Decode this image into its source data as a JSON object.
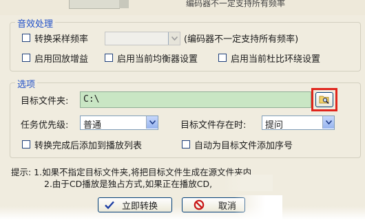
{
  "top": {
    "hint_text": "编码器不一定支持所有频率"
  },
  "audio_group": {
    "title": "音效处理",
    "convert_samplerate_label": "转换采样频率",
    "samplerate_value": "",
    "samplerate_note": "(编码器不一定支持所有频率)",
    "replay_gain_label": "启用回放增益",
    "equalizer_label": "启用当前均衡器设置",
    "dolby_label": "启用当前杜比环绕设置"
  },
  "options_group": {
    "title": "选项",
    "target_folder_label": "目标文件夹:",
    "target_folder_value": "C:\\",
    "priority_label": "任务优先级:",
    "priority_value": "普通",
    "exists_label": "目标文件存在时:",
    "exists_value": "提问",
    "add_playlist_label": "转换完成后添加到播放列表",
    "add_seq_label": "自动为目标文件添加序号"
  },
  "tips": {
    "line1": "提示: 1.如果不指定目标文件夹,将把目标文件生成在源文件夹内",
    "line2": "2.由于CD播放是独占方式,如果正在播放CD,"
  },
  "buttons": {
    "convert": "立即转换",
    "cancel": "取消"
  },
  "colors": {
    "accent": "#1f4fc8",
    "highlight": "#e0241b",
    "field_green": "#c9e6c4"
  }
}
